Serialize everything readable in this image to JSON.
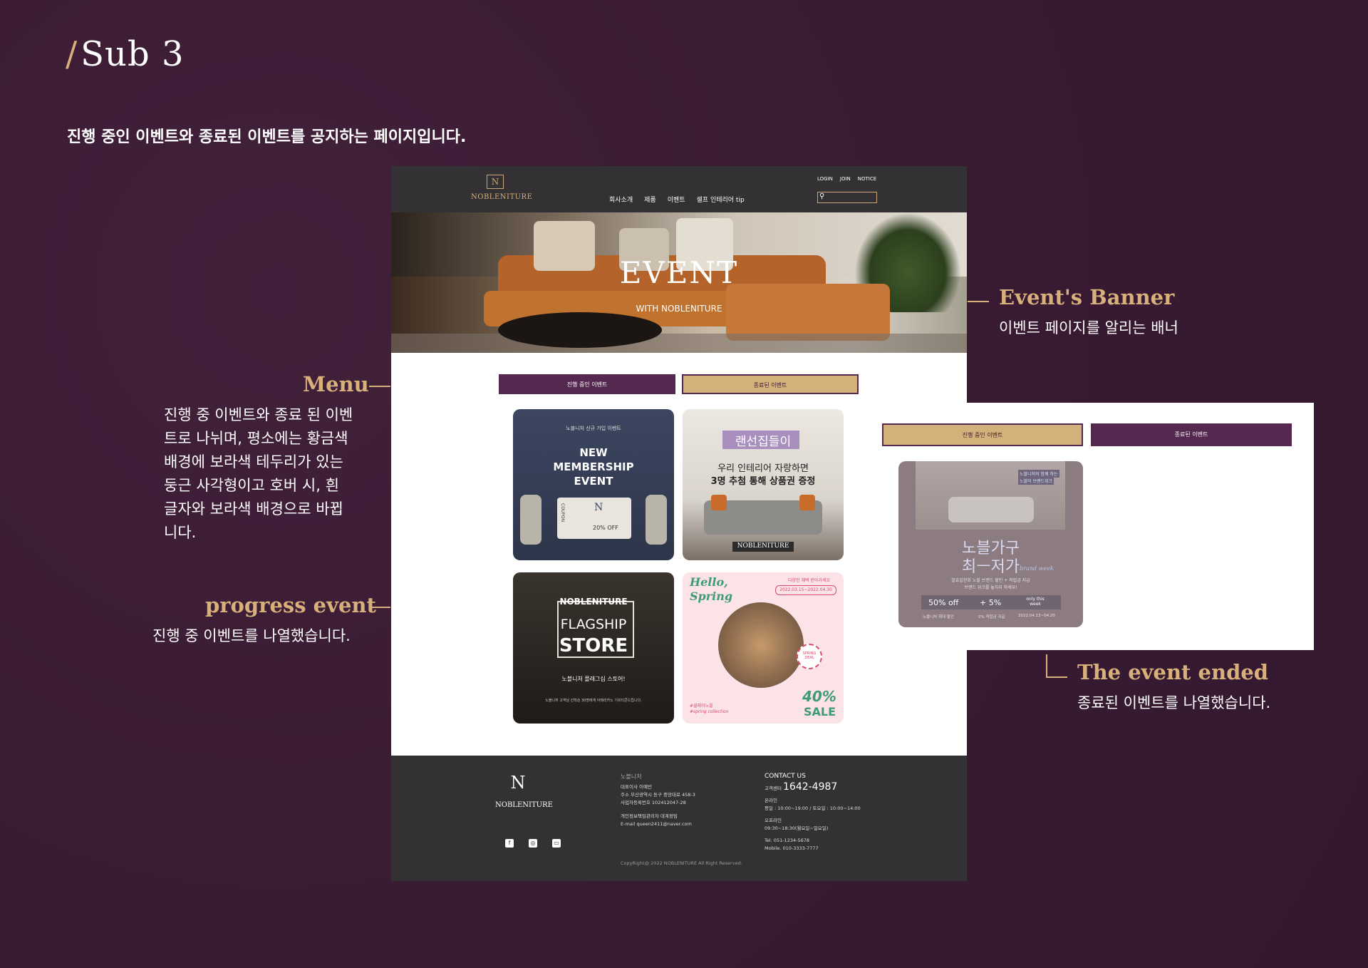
{
  "page": {
    "title_slash": "/",
    "title": "Sub 3",
    "description": "진행 중인 이벤트와 종료된 이벤트를 공지하는 페이지입니다."
  },
  "annotations": {
    "banner": {
      "heading": "Event's Banner",
      "text": "이벤트 페이지를 알리는 배너"
    },
    "menu": {
      "heading": "Menu",
      "lines": [
        "진행 중 이벤트와 종료 된 이벤",
        "트로 나뉘며, 평소에는 황금색",
        "배경에 보라색 테두리가 있는",
        "둥근 사각형이고 호버 시, 흰",
        "글자와 보라색 배경으로 바뀝",
        "니다."
      ]
    },
    "progress": {
      "heading": "progress event",
      "text": "진행 중 이벤트를 나열했습니다."
    },
    "ended": {
      "heading": "The event ended",
      "text": "종료된 이벤트를 나열했습니다."
    }
  },
  "site": {
    "brand": "NOBLENITURE",
    "logo_mark": "N",
    "nav": [
      "회사소개",
      "제품",
      "이벤트",
      "셀프 인테리어 tip"
    ],
    "util": [
      "LOGIN",
      "JOIN",
      "NOTICE"
    ],
    "search_icon": "search-icon",
    "banner": {
      "title": "EVENT",
      "subtitle": "WITH NOBLENITURE"
    },
    "tabs": {
      "active": "진행 중인 이벤트",
      "ended": "종료된 이벤트"
    },
    "cards": {
      "membership": {
        "top": "노블니처 신규 가입 이벤트",
        "title1": "NEW",
        "title2": "MEMBERSHIP",
        "title3": "EVENT",
        "coupon": "COUPON",
        "discount": "20% OFF"
      },
      "housewarming": {
        "tag": "랜선집들이",
        "line1": "우리 인테리어 자랑하면",
        "line2": "3명 추첨 통해 상품권 증정",
        "brand": "NOBLENITURE"
      },
      "flagship": {
        "brand": "NOBLENITURE",
        "title1": "FLAGSHIP",
        "title2": "STORE",
        "line": "노블니처 플래그십 스토어!",
        "small": "노블니처 고객님 선착순 30명에게 아메리카노 기프티콘드립니다."
      },
      "spring": {
        "title1": "Hello,",
        "title2": "Spring",
        "top": "다양한 혜택 받아가세요",
        "dates": "2022.03.15~2022.04.30",
        "badge1": "SPRING",
        "badge2": "DEAL",
        "hashtag1": "#쉴래이노블",
        "hashtag2": "#spring collection",
        "pct": "40%",
        "sale": "SALE"
      }
    },
    "footer": {
      "brand": "NOBLENITURE",
      "company": "노블니처",
      "info": [
        "대표이사 이예빈",
        "주소 부산광역시 동구 중앙대로 458-3",
        "사업자등록번호 102412047-28"
      ],
      "privacy": [
        "개인정보책임관리자 대계정팀",
        "E-mail queen2411@naver.com"
      ],
      "copyright": "CopyRight@ 2022 NOBLENITURE All Right Reserved.",
      "contact_head": "CONTACT US",
      "cs_label": "고객센터",
      "cs_number": "1642-4987",
      "online": "온라인",
      "online_hours": "평일 : 10:00~19:00 / 토요일 : 10:00~14:00",
      "offline": "오프라인",
      "offline_hours": "09:30~18:30(월요일~일요일)",
      "tel": "Tel. 051-1234-5678",
      "mobile": "Mobile. 010-3333-7777",
      "social": [
        "facebook-icon",
        "instagram-icon",
        "chat-icon"
      ]
    }
  },
  "ended_panel": {
    "tabs": {
      "active": "진행 중인 이벤트",
      "ended": "종료된 이벤트"
    },
    "card": {
      "top1": "노블니처와 함께 하는",
      "top2": "노블미 브랜드위크",
      "title1": "노블가구",
      "title2": "최ㅡ저가",
      "script": "brand week",
      "line1": "발효일한회 노블 브랜드 할인 + 적립금 지급",
      "line2": "브랜드 위크를 놓치지 마세요!",
      "off": "50% off",
      "plus": "+ 5%",
      "week": "only this week",
      "b1": "노블니처 최대 할인",
      "b2": "5% 적립금 지급",
      "b3": "2022.04.13~04.20"
    }
  }
}
